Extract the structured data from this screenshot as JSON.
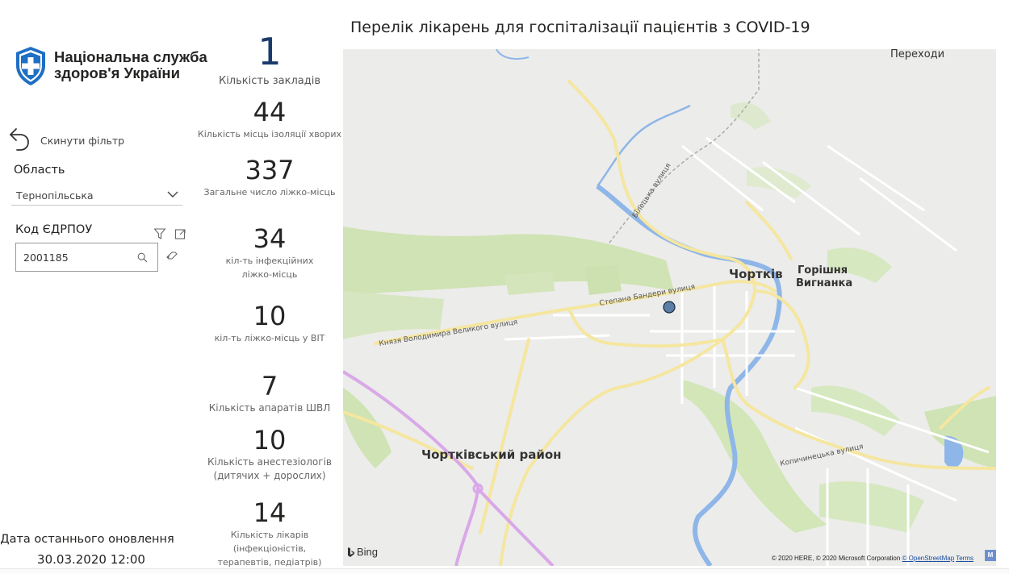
{
  "page": {
    "title": "Перелік лікарень для госпіталізації пацієнтів з COVID-19"
  },
  "logo": {
    "line1": "Національна служба",
    "line2": "здоров'я України",
    "icon": "shield-cross-icon",
    "color": "#1f6fc4"
  },
  "filters": {
    "reset_label": "Скинути фільтр",
    "oblast": {
      "title": "Область",
      "selected": "Тернопільська"
    },
    "edrpou": {
      "title": "Код ЄДРПОУ",
      "value": "2001185"
    }
  },
  "kpis": [
    {
      "value": "1",
      "label": "Кількість закладів"
    },
    {
      "value": "44",
      "label": "Кількість місць ізоляції хворих"
    },
    {
      "value": "337",
      "label": "Загальне число ліжко-місць"
    },
    {
      "value": "34",
      "label_line1": "кіл-ть інфекційних",
      "label_line2": "ліжко-місць"
    },
    {
      "value": "10",
      "label": "кіл-ть ліжко-місць у ВІТ"
    },
    {
      "value": "7",
      "label": "Кількість апаратів ШВЛ"
    },
    {
      "value": "10",
      "label_line1": "Кількість анестезіологів",
      "label_line2": "(дитячих + дорослих)"
    },
    {
      "value": "14",
      "label_line1": "Кількість лікарів (інфекціоністів,",
      "label_line2": "терапевтів, педіатрів)"
    }
  ],
  "update": {
    "title": "Дата останнього оновлення",
    "value": "30.03.2020 12:00"
  },
  "map": {
    "places": {
      "chortkiv": "Чортків",
      "horishnia1": "Горішня",
      "horishnia2": "Вигнанка",
      "district": "Чортківський район",
      "perekhody": "Переходи"
    },
    "streets": {
      "bandery": "Степана Бандери вулиця",
      "velykoho": "Князя Володимира Великого вулиця",
      "bilecka": "Білецька вулиця",
      "kopychynetska": "Копичинецька вулиця"
    },
    "bing": "Bing",
    "attribution_text": "© 2020 HERE, © 2020 Microsoft Corporation",
    "osm": "© OpenStreetMap",
    "terms": "Terms",
    "badge": "M",
    "colors": {
      "water": "#8fb6e8",
      "green": "#cfe3b4",
      "road": "#f5e6a0",
      "highway": "#d9a8e8",
      "marker": "#5b7fa6"
    }
  }
}
